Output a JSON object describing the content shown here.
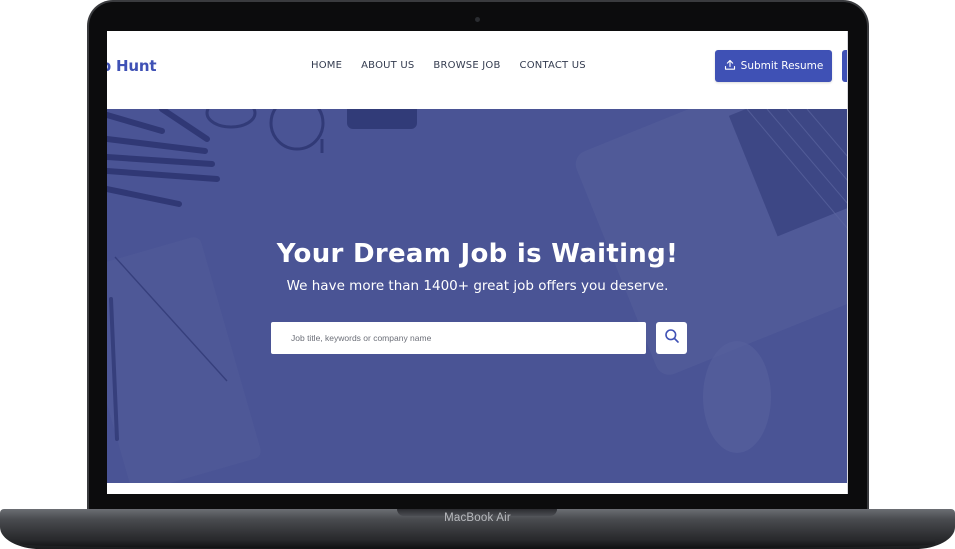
{
  "device": {
    "model_label": "MacBook Air"
  },
  "site": {
    "logo_text": "Job Hunt",
    "nav": {
      "home": "HOME",
      "about": "ABOUT US",
      "browse": "BROWSE JOB",
      "contact": "CONTACT US"
    },
    "submit_button": "Submit Resume",
    "hero": {
      "title": "Your Dream Job is Waiting!",
      "subtitle": "We have more than 1400+ great job offers you deserve.",
      "search_placeholder": "Job title, keywords or company name"
    }
  },
  "colors": {
    "accent": "#3f51b5",
    "hero_overlay": "#4a5495",
    "nav_text": "#333b4f"
  },
  "icons": {
    "submit": "upload-icon",
    "search": "search-icon"
  }
}
